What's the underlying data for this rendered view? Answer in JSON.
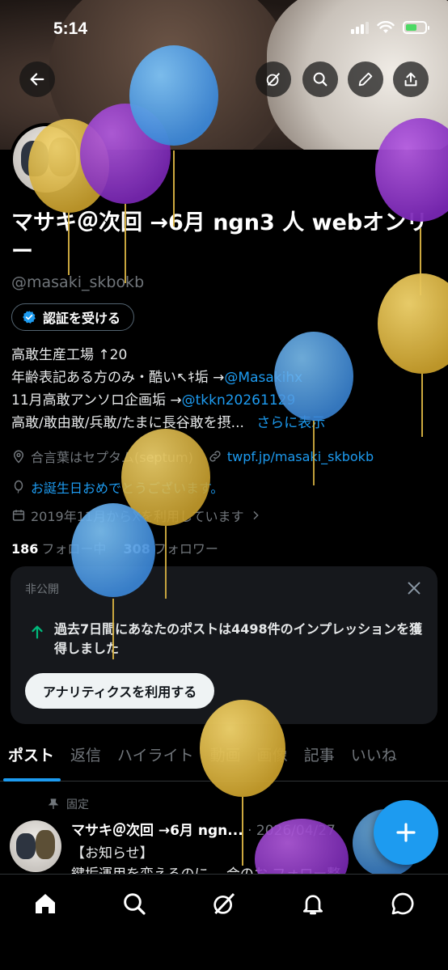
{
  "status_bar": {
    "time": "5:14"
  },
  "header_actions": {
    "back": "back-arrow-icon",
    "grok": "grok-icon",
    "search": "search-icon",
    "edit": "pencil-icon",
    "share": "share-icon"
  },
  "profile": {
    "name": "マサキ＠次回 →6月 ngn3 人 webオンリー",
    "handle": "@masaki_skbokb",
    "verify_label": "認証を受ける",
    "bio": {
      "line1": "高敢生産工場 ↑20",
      "line2_text": "年齢表記ある方のみ・酷い↖ｷ垢 →",
      "line2_link": "@Masakihx",
      "line3_text": "11月高敢アンソロ企画垢 →",
      "line3_link": "@tkkn20261129",
      "line4_text": "高敢/敢由敢/兵敢/たまに長谷敢を摂...",
      "line4_more": "さらに表示"
    },
    "location": "合言葉はセプタム(septum)",
    "website": "twpf.jp/masaki_skbokb",
    "birthday": "お誕生日おめでとうございます。",
    "joined": "2019年11月からXを利用しています",
    "following_count": "186",
    "following_label": "フォロー中",
    "followers_count": "308",
    "followers_label": "フォロワー"
  },
  "insight_card": {
    "label": "非公開",
    "message": "過去7日間にあなたのポストは4498件のインプレッションを獲得しました",
    "cta": "アナリティクスを利用する"
  },
  "tabs": [
    {
      "label": "ポスト"
    },
    {
      "label": "返信"
    },
    {
      "label": "ハイライト"
    },
    {
      "label": "動画"
    },
    {
      "label": "画像"
    },
    {
      "label": "記事"
    },
    {
      "label": "いいね"
    }
  ],
  "pinned_post": {
    "pinned_label": "固定",
    "author": "マサキ＠次回 →6月 ngn...",
    "date": "· 2026/04/27",
    "line1": "【お知らせ】",
    "line2": "鍵垢運用を変えるのに… 会のお フォロー整"
  },
  "bottom_nav": [
    "home-icon",
    "search-icon",
    "grok-icon",
    "notifications-icon",
    "messages-icon"
  ],
  "colors": {
    "accent": "#1d9bf0",
    "background": "#000000",
    "muted": "#71767b"
  }
}
